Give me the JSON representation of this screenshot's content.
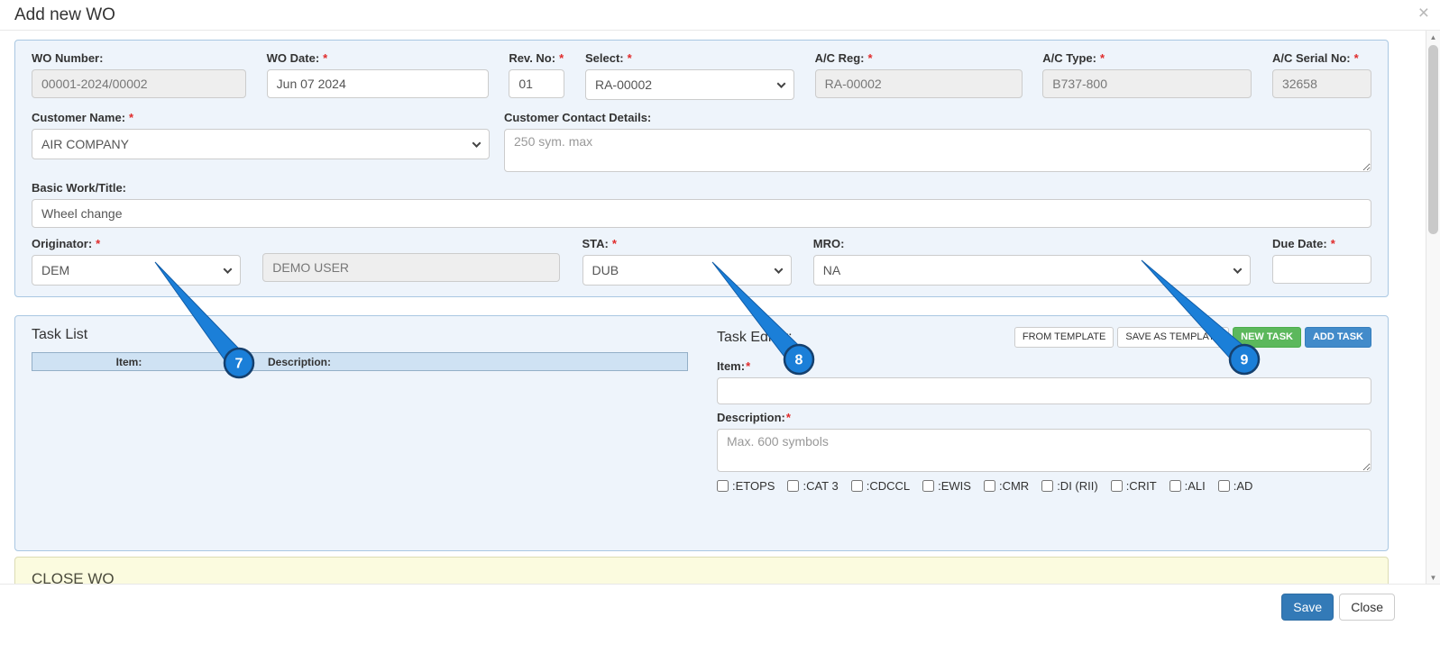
{
  "modal": {
    "title": "Add new WO"
  },
  "icons": {
    "close": "×",
    "scroll_up": "▲",
    "scroll_down": "▼"
  },
  "required_mark": "*",
  "form": {
    "wo_number": {
      "label": "WO Number:",
      "value": "00001-2024/00002"
    },
    "wo_date": {
      "label": "WO Date:",
      "value": "Jun 07 2024"
    },
    "rev_no": {
      "label": "Rev. No:",
      "value": "01"
    },
    "select_reg": {
      "label": "Select:",
      "value": "RA-00002"
    },
    "ac_reg": {
      "label": "A/C Reg:",
      "value": "RA-00002"
    },
    "ac_type": {
      "label": "A/C Type:",
      "value": "B737-800"
    },
    "ac_serial_no": {
      "label": "A/C Serial No:",
      "value": "32658"
    },
    "customer_name": {
      "label": "Customer Name:",
      "value": "AIR COMPANY"
    },
    "customer_contact": {
      "label": "Customer Contact Details:",
      "placeholder": "250 sym. max"
    },
    "basic_work_title": {
      "label": "Basic Work/Title:",
      "value": "Wheel change"
    },
    "originator": {
      "label": "Originator:",
      "value": "DEM"
    },
    "originator_user": {
      "value": "DEMO USER"
    },
    "sta": {
      "label": "STA:",
      "value": "DUB"
    },
    "mro": {
      "label": "MRO:",
      "value": "NA"
    },
    "due_date": {
      "label": "Due Date:",
      "value": ""
    }
  },
  "tasks": {
    "list_title": "Task List",
    "columns": {
      "item": "Item:",
      "description": "Description:"
    },
    "editor_title": "Task Editor:",
    "buttons": {
      "from_template": "FROM TEMPLATE",
      "save_as_template": "SAVE AS TEMPLATE",
      "new_task": "NEW TASK",
      "add_task": "ADD TASK"
    },
    "item_label": "Item:",
    "description_label": "Description:",
    "description_placeholder": "Max. 600 symbols",
    "flags": [
      ":ETOPS",
      ":CAT 3",
      ":CDCCL",
      ":EWIS",
      ":CMR",
      ":DI (RII)",
      ":CRIT",
      ":ALI",
      ":AD"
    ]
  },
  "close_wo": {
    "title": "CLOSE WO"
  },
  "footer": {
    "save": "Save",
    "close": "Close"
  },
  "annotations": {
    "seven": "7",
    "eight": "8",
    "nine": "9"
  },
  "colors": {
    "accent_blue": "#337ab7",
    "button_green": "#5cb85c",
    "button_blue": "#428bca",
    "annotation_blue": "#1b7fd8",
    "panel_bg": "#eef4fb",
    "panel_border": "#a9c7e2",
    "close_wo_bg": "#fbfbdf",
    "required_red": "#e02b2b"
  }
}
